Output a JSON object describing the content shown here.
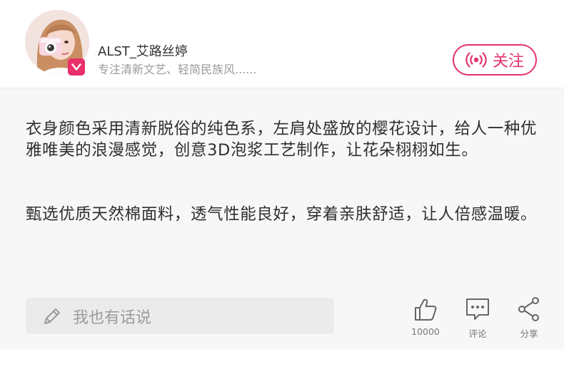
{
  "header": {
    "username": "ALST_艾路丝婷",
    "bio": "专注清新文艺、轻简民族风......",
    "follow_label": "关注"
  },
  "post": {
    "paragraphs": [
      "衣身颜色采用清新脱俗的纯色系，左肩处盛放的樱花设计，给人一种优雅唯美的浪漫感觉，创意3D泡浆工艺制作，让花朵栩栩如生。",
      "甄选优质天然棉面料，透气性能良好，穿着亲肤舒适，让人倍感温暖。"
    ]
  },
  "footer": {
    "comment_placeholder": "我也有话说",
    "actions": {
      "like_count": "10000",
      "comment_label": "评论",
      "share_label": "分享"
    }
  },
  "colors": {
    "accent": "#e2336b",
    "badge": "#e9306a",
    "content_bg": "#f7f7f7",
    "input_bg": "#ebebeb"
  },
  "icons": [
    "verified-v-icon",
    "broadcast-icon",
    "pencil-icon",
    "thumbs-up-icon",
    "comment-icon",
    "share-icon"
  ]
}
